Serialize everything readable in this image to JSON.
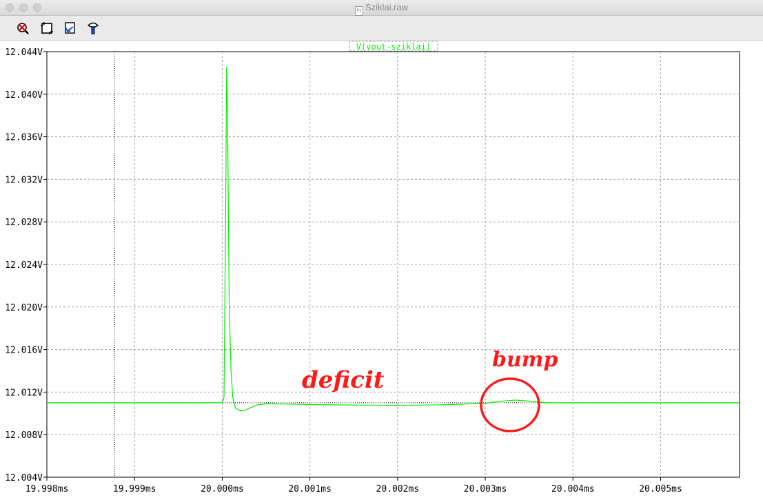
{
  "window": {
    "title": "Sziklai.raw",
    "doc_icon_label": "Ps"
  },
  "toolbar": {
    "buttons": [
      {
        "name": "zoom-out-icon"
      },
      {
        "name": "zoom-full-icon"
      },
      {
        "name": "pan-undo-icon"
      },
      {
        "name": "cursor-probe-icon"
      }
    ]
  },
  "colors": {
    "trace": "#00ee00",
    "grid": "#a0a0a0",
    "annotation": "#ff1a1a",
    "axis": "#000000"
  },
  "plot": {
    "trace_label": "V(vout-sziklai)"
  },
  "annotations": {
    "deficit": "deficit",
    "bump": "bump"
  },
  "chart_data": {
    "type": "line",
    "xlabel": "",
    "ylabel": "",
    "xlim": [
      19.998,
      20.0059
    ],
    "ylim": [
      12.004,
      12.044
    ],
    "grid": true,
    "x_ticks": [
      19.998,
      19.999,
      20.0,
      20.001,
      20.002,
      20.003,
      20.004,
      20.005
    ],
    "x_tick_labels": [
      "19.998ms",
      "19.999ms",
      "20.000ms",
      "20.001ms",
      "20.002ms",
      "20.003ms",
      "20.004ms",
      "20.005ms"
    ],
    "y_ticks": [
      12.004,
      12.008,
      12.012,
      12.016,
      12.02,
      12.024,
      12.028,
      12.032,
      12.036,
      12.04,
      12.044
    ],
    "y_tick_labels": [
      "12.004V",
      "12.008V",
      "12.012V",
      "12.016V",
      "12.020V",
      "12.024V",
      "12.028V",
      "12.032V",
      "12.036V",
      "12.040V",
      "12.044V"
    ],
    "cursor_x": 19.99877,
    "series": [
      {
        "name": "V(vout-sziklai)",
        "color": "#00ee00",
        "x": [
          19.998,
          20.0,
          20.00002,
          20.00004,
          20.00005,
          20.00006,
          20.00008,
          20.0001,
          20.00012,
          20.00015,
          20.0002,
          20.00025,
          20.0003,
          20.0004,
          20.0005,
          20.0007,
          20.001,
          20.0015,
          20.002,
          20.0025,
          20.003,
          20.0032,
          20.00335,
          20.0035,
          20.0037,
          20.004,
          20.005,
          20.0059
        ],
        "y": [
          12.011,
          12.011,
          12.0115,
          12.03,
          12.0426,
          12.038,
          12.02,
          12.014,
          12.0115,
          12.0105,
          12.01025,
          12.01025,
          12.01045,
          12.0108,
          12.0109,
          12.01088,
          12.01083,
          12.01078,
          12.01075,
          12.0108,
          12.01095,
          12.01115,
          12.01125,
          12.01115,
          12.011,
          12.011,
          12.011,
          12.011
        ]
      }
    ]
  }
}
